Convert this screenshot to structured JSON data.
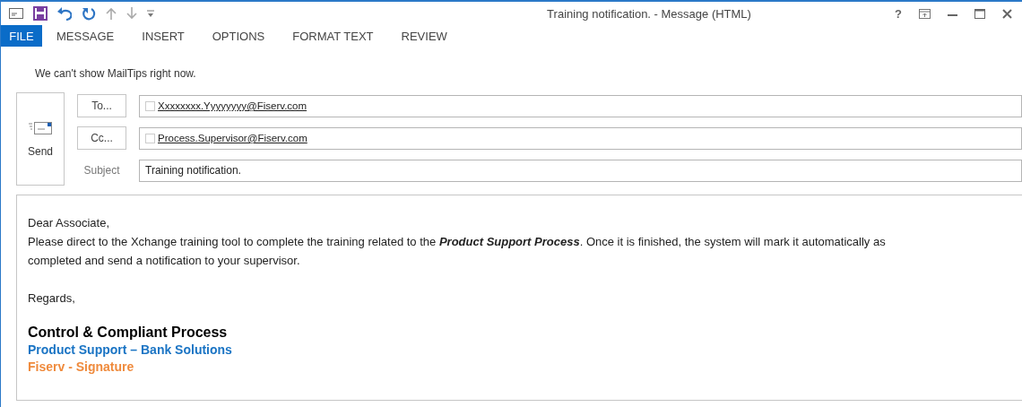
{
  "window": {
    "title": "Training notification. - Message (HTML)"
  },
  "quick_access": [
    {
      "kind": "envelope"
    },
    {
      "kind": "save"
    },
    {
      "kind": "undo"
    },
    {
      "kind": "redo"
    },
    {
      "kind": "up"
    },
    {
      "kind": "down"
    },
    {
      "kind": "more"
    }
  ],
  "window_controls": [
    "?"
  ],
  "tabs": [
    {
      "label": "FILE",
      "selected": true
    },
    {
      "label": "MESSAGE",
      "selected": false
    },
    {
      "label": "INSERT",
      "selected": false
    },
    {
      "label": "OPTIONS",
      "selected": false
    },
    {
      "label": "FORMAT TEXT",
      "selected": false
    },
    {
      "label": "REVIEW",
      "selected": false
    }
  ],
  "mailtips": "We can't show MailTips right now.",
  "send_button": "Send",
  "recipients": [
    {
      "button": "To...",
      "address": "Xxxxxxxx.Yyyyyyyy@Fiserv.com",
      "checked": false
    },
    {
      "button": "Cc...",
      "address": "Process.Supervisor@Fiserv.com",
      "checked": false
    }
  ],
  "subject": {
    "label": "Subject",
    "value": "Training notification."
  },
  "body": {
    "greeting": "Dear Associate,",
    "paragraph": "Please direct to the Xchange training tool to complete the training related to the **Product Support Process**. Once it is finished, the system will mark it automatically as completed and send a notification to your supervisor.",
    "closing": "Regards,",
    "signature": [
      {
        "text": "Control & Compliant Process",
        "color": "#000000"
      },
      {
        "text": "Product Support – Bank Solutions",
        "color": "#1a74c4"
      },
      {
        "text": "Fiserv - Signature",
        "color": "#ef8a3c"
      }
    ]
  }
}
